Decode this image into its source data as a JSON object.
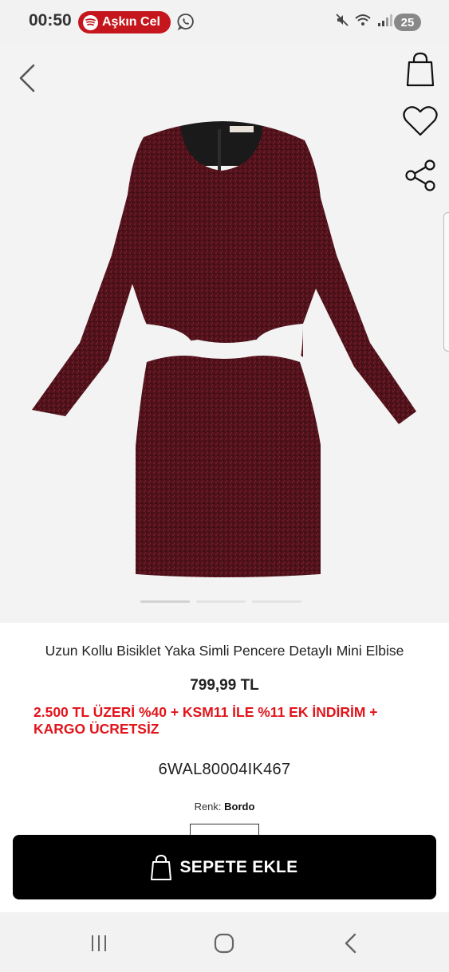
{
  "status_bar": {
    "time": "00:50",
    "media_text": "Aşkın Cel",
    "battery": "25"
  },
  "product": {
    "title": "Uzun Kollu Bisiklet Yaka Simli Pencere Detaylı Mini Elbise",
    "price": "799,99 TL",
    "promo": "2.500 TL ÜZERİ %40 + KSM11 İLE %11 EK İNDİRİM + KARGO ÜCRETSİZ",
    "sku": "6WAL80004IK467",
    "color_label": "Renk:",
    "color_value": "Bordo",
    "image_count": 3,
    "active_image": 1
  },
  "actions": {
    "add_to_cart": "SEPETE EKLE"
  },
  "icons": [
    "back-icon",
    "shopping-bag-icon",
    "heart-icon",
    "share-icon",
    "recents-icon",
    "home-icon",
    "nav-back-icon"
  ],
  "colors": {
    "promo": "#e2141b",
    "cart_button": "#000000",
    "media_pill": "#c4161c",
    "dress": "#5c1620"
  }
}
